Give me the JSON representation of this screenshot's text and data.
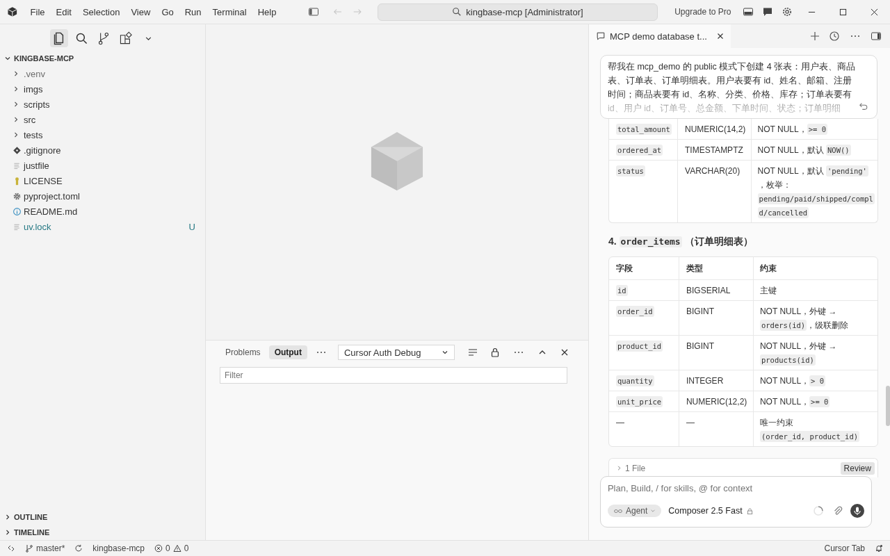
{
  "titlebar": {
    "menu": [
      "File",
      "Edit",
      "Selection",
      "View",
      "Go",
      "Run",
      "Terminal",
      "Help"
    ],
    "search": "kingbase-mcp [Administrator]",
    "upgrade": "Upgrade to Pro"
  },
  "sidebar": {
    "root": "KINGBASE-MCP",
    "items": [
      {
        "name": ".venv",
        "kind": "folder",
        "dim": true
      },
      {
        "name": "imgs",
        "kind": "folder",
        "dim": false
      },
      {
        "name": "scripts",
        "kind": "folder",
        "dim": false
      },
      {
        "name": "src",
        "kind": "folder",
        "dim": false
      },
      {
        "name": "tests",
        "kind": "folder",
        "dim": false
      },
      {
        "name": ".gitignore",
        "kind": "git",
        "dim": false
      },
      {
        "name": "justfile",
        "kind": "text",
        "dim": false
      },
      {
        "name": "LICENSE",
        "kind": "license",
        "dim": false
      },
      {
        "name": "pyproject.toml",
        "kind": "config",
        "dim": false
      },
      {
        "name": "README.md",
        "kind": "info",
        "dim": false
      },
      {
        "name": "uv.lock",
        "kind": "text",
        "dim": false,
        "status": "U"
      }
    ],
    "sections": [
      "OUTLINE",
      "TIMELINE"
    ]
  },
  "panel": {
    "tabs": [
      {
        "label": "Problems",
        "selected": false
      },
      {
        "label": "Output",
        "selected": true
      }
    ],
    "channel": "Cursor Auth Debug",
    "filter_placeholder": "Filter"
  },
  "chat": {
    "tab_title": "MCP demo database t...",
    "message": "帮我在 mcp_demo 的 public 模式下创建 4 张表：用户表、商品表、订单表、订单明细表。用户表要有 id、姓名、邮箱、注册时间；商品表要有 id、名称、分类、价格、库存；订单表要有 id、用户 id、订单号、总金额、下单时间、状态；订单明细",
    "table_1": {
      "rows": [
        [
          [
            {
              "kind": "code",
              "text": "total_amount"
            }
          ],
          [
            {
              "kind": "text",
              "text": "NUMERIC(14,2)"
            }
          ],
          [
            {
              "kind": "text",
              "text": "NOT NULL，"
            },
            {
              "kind": "code",
              "text": ">= 0"
            }
          ]
        ],
        [
          [
            {
              "kind": "code",
              "text": "ordered_at"
            }
          ],
          [
            {
              "kind": "text",
              "text": "TIMESTAMPTZ"
            }
          ],
          [
            {
              "kind": "text",
              "text": "NOT NULL，默认 "
            },
            {
              "kind": "code",
              "text": "NOW()"
            }
          ]
        ],
        [
          [
            {
              "kind": "code",
              "text": "status"
            }
          ],
          [
            {
              "kind": "text",
              "text": "VARCHAR(20)"
            }
          ],
          [
            {
              "kind": "text",
              "text": "NOT NULL，默认 "
            },
            {
              "kind": "code",
              "text": "'pending'"
            },
            {
              "kind": "text",
              "text": "，枚举："
            },
            {
              "kind": "code",
              "text": "pending/paid/shipped/compl"
            },
            {
              "kind": "code",
              "text": "d/cancelled"
            }
          ]
        ]
      ]
    },
    "heading": [
      {
        "kind": "text",
        "text": "4. "
      },
      {
        "kind": "code",
        "text": "order_items"
      },
      {
        "kind": "text",
        "text": " （订单明细表）"
      }
    ],
    "table_2": {
      "columns": [
        "字段",
        "类型",
        "约束"
      ],
      "rows": [
        [
          [
            {
              "kind": "code",
              "text": "id"
            }
          ],
          [
            {
              "kind": "text",
              "text": "BIGSERIAL"
            }
          ],
          [
            {
              "kind": "text",
              "text": "主键"
            }
          ]
        ],
        [
          [
            {
              "kind": "code",
              "text": "order_id"
            }
          ],
          [
            {
              "kind": "text",
              "text": "BIGINT"
            }
          ],
          [
            {
              "kind": "text",
              "text": "NOT NULL，外键 → "
            },
            {
              "kind": "code",
              "text": "orders(id)"
            },
            {
              "kind": "text",
              "text": "，级联删除"
            }
          ]
        ],
        [
          [
            {
              "kind": "code",
              "text": "product_id"
            }
          ],
          [
            {
              "kind": "text",
              "text": "BIGINT"
            }
          ],
          [
            {
              "kind": "text",
              "text": "NOT NULL，外键 → "
            },
            {
              "kind": "code",
              "text": "products(id)"
            }
          ]
        ],
        [
          [
            {
              "kind": "code",
              "text": "quantity"
            }
          ],
          [
            {
              "kind": "text",
              "text": "INTEGER"
            }
          ],
          [
            {
              "kind": "text",
              "text": "NOT NULL，"
            },
            {
              "kind": "code",
              "text": "> 0"
            }
          ]
        ],
        [
          [
            {
              "kind": "code",
              "text": "unit_price"
            }
          ],
          [
            {
              "kind": "text",
              "text": "NUMERIC(12,2)"
            }
          ],
          [
            {
              "kind": "text",
              "text": "NOT NULL，"
            },
            {
              "kind": "code",
              "text": ">= 0"
            }
          ]
        ],
        [
          [
            {
              "kind": "text",
              "text": "—"
            }
          ],
          [
            {
              "kind": "text",
              "text": "—"
            }
          ],
          [
            {
              "kind": "text",
              "text": "唯一约束 "
            },
            {
              "kind": "code",
              "text": "(order_id, product_id)"
            }
          ]
        ]
      ]
    },
    "files": {
      "label": "1 File",
      "action": "Review"
    },
    "composer": {
      "placeholder": "Plan, Build, / for skills, @ for context",
      "mode": "Agent",
      "model": "Composer 2.5 Fast"
    }
  },
  "status_bar": {
    "branch": "master*",
    "project": "kingbase-mcp",
    "errors": "0",
    "warnings": "0",
    "right": "Cursor Tab"
  }
}
